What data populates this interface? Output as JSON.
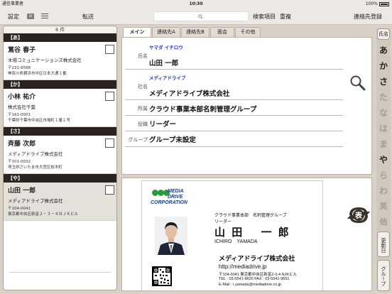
{
  "status": {
    "carrier": "通信事業者",
    "time": "10:30",
    "battery": "100%"
  },
  "toolbar": {
    "settings": "設定",
    "dt_badge": "Dt",
    "transfer": "転送",
    "search_placeholder": "",
    "search_item": "検索項目",
    "duplicate": "重複",
    "register": "連絡先登録"
  },
  "list": {
    "count": "4 件",
    "sections": [
      {
        "header": "【あ】",
        "name": "鴬谷 春子",
        "company": "木場コミュニケーションズ株式会社",
        "zip": "〒231-8588",
        "address": "神奈川県横浜市中区日本大通１番"
      },
      {
        "header": "【か】",
        "name": "小林 祐介",
        "company": "株式会社千葉",
        "zip": "〒161-0001",
        "address": "千葉県千葉市中央区市場町１番１号"
      },
      {
        "header": "【さ】",
        "name": "斉藤 次郎",
        "company": "メディアドライブ株式会社",
        "zip": "〒101-0032",
        "address": "埼玉県さいたま市大宮区桜木町"
      },
      {
        "header": "【や】",
        "name": "山田 一郎",
        "company": "メディアドライブ株式会社",
        "zip": "〒104-0041",
        "address": "東京都中央区新富２－３－４ＮＪＫビル"
      }
    ]
  },
  "tabs": [
    "メイン",
    "連絡先A",
    "連絡先B",
    "面会",
    "その他"
  ],
  "detail": {
    "name_label": "氏名",
    "name_kana": "ヤマダ イチロウ",
    "name": "山田 一郎",
    "company_label": "社名",
    "company_kana": "メディアドライブ",
    "company": "メディアドライブ株式会社",
    "dept_label": "所属",
    "dept": "クラウド事業本部名刺管理グループ",
    "title_label": "役職",
    "title": "リーダー",
    "group_label": "グループ",
    "group": "グループ未設定"
  },
  "bizcard": {
    "logo_lines": [
      "MEDIA",
      "DRIVE",
      "CORPORATION"
    ],
    "dept": "クラウド事業本部　名刺管理グループ",
    "title": "リーダー",
    "name": "山 田　 一 郎",
    "roman": "ICHIRO　YAMADA",
    "company": "メディアドライブ株式会社",
    "url": "http://mediadrive.jp",
    "address": "〒104-0041 東京都中央区新富2-3-4 NJKビル",
    "tel": "TEL : 03-5541-9620  FAX : 03-5541-9651",
    "email": "E-Mail : i.yamada@mediadrive.co.jp"
  },
  "flip_label": "表",
  "index": {
    "header": "氏名",
    "kana": [
      "あ",
      "か",
      "さ",
      "た",
      "な",
      "は",
      "ま",
      "や",
      "ら",
      "わ",
      "英",
      "他"
    ],
    "updated": "更新日",
    "group": "グループ"
  },
  "colors": {
    "section_bg": "#2b2320",
    "kana_blue": "#2233dd",
    "logo_green": "#2d9a3a",
    "logo_blue": "#1c3f8c"
  }
}
